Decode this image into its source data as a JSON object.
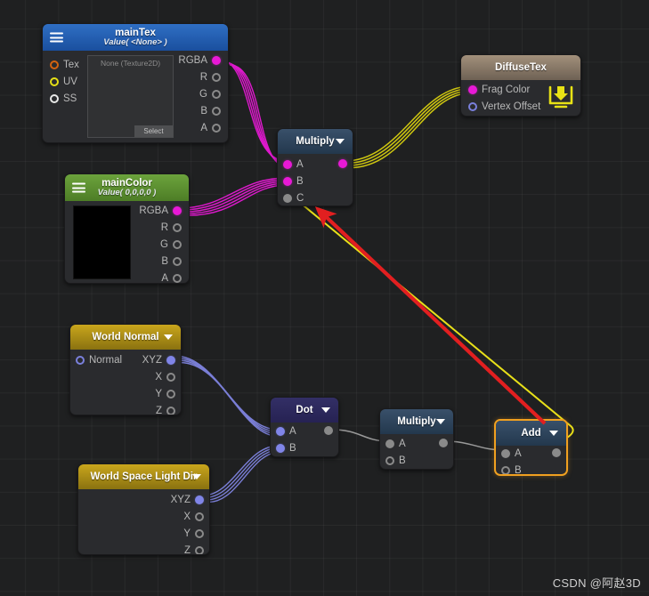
{
  "app": {
    "watermark": "CSDN @阿赵3D"
  },
  "nodes": {
    "main_tex": {
      "title": "mainTex",
      "subtitle": "Value( <None> )",
      "menu_icon": "hamburger-icon",
      "inputs": [
        {
          "label": "Tex",
          "port": "ring-orange"
        },
        {
          "label": "UV",
          "port": "ring-yellow"
        },
        {
          "label": "SS",
          "port": "ring-white"
        }
      ],
      "outputs": [
        {
          "label": "RGBA",
          "port": "filled-mag"
        },
        {
          "label": "R",
          "port": "ring-gray"
        },
        {
          "label": "G",
          "port": "ring-gray"
        },
        {
          "label": "B",
          "port": "ring-gray"
        },
        {
          "label": "A",
          "port": "ring-gray"
        }
      ],
      "texture_preview_label": "None (Texture2D)",
      "select_button": "Select"
    },
    "main_color": {
      "title": "mainColor",
      "subtitle": "Value( 0,0,0,0 )",
      "menu_icon": "hamburger-icon",
      "color_value": "#000000",
      "outputs": [
        {
          "label": "RGBA",
          "port": "filled-mag"
        },
        {
          "label": "R",
          "port": "ring-gray"
        },
        {
          "label": "G",
          "port": "ring-gray"
        },
        {
          "label": "B",
          "port": "ring-gray"
        },
        {
          "label": "A",
          "port": "ring-gray"
        }
      ]
    },
    "diffuse_tex": {
      "title": "DiffuseTex",
      "inputs": [
        {
          "label": "Frag Color",
          "port": "filled-mag"
        },
        {
          "label": "Vertex Offset",
          "port": "ring-blue"
        }
      ],
      "badge_icon": "save-download-icon"
    },
    "multiply_top": {
      "title": "Multiply",
      "dropdown_icon": "chevron-down-icon",
      "inputs": [
        {
          "label": "A",
          "port": "filled-mag"
        },
        {
          "label": "B",
          "port": "filled-mag"
        },
        {
          "label": "C",
          "port": "filled-gray"
        }
      ],
      "outputs": [
        {
          "label": "",
          "port": "filled-mag"
        }
      ]
    },
    "world_normal": {
      "title": "World Normal",
      "dropdown_icon": "chevron-down-icon",
      "inputs": [
        {
          "label": "Normal",
          "port": "ring-blue"
        }
      ],
      "outputs": [
        {
          "label": "XYZ",
          "port": "filled-blue"
        },
        {
          "label": "X",
          "port": "ring-gray"
        },
        {
          "label": "Y",
          "port": "ring-gray"
        },
        {
          "label": "Z",
          "port": "ring-gray"
        }
      ]
    },
    "world_light_dir": {
      "title": "World Space Light Dir",
      "dropdown_icon": "chevron-down-icon",
      "outputs": [
        {
          "label": "XYZ",
          "port": "filled-blue"
        },
        {
          "label": "X",
          "port": "ring-gray"
        },
        {
          "label": "Y",
          "port": "ring-gray"
        },
        {
          "label": "Z",
          "port": "ring-gray"
        }
      ]
    },
    "dot": {
      "title": "Dot",
      "dropdown_icon": "chevron-down-icon",
      "inputs": [
        {
          "label": "A",
          "port": "filled-blue"
        },
        {
          "label": "B",
          "port": "filled-blue"
        }
      ],
      "outputs": [
        {
          "label": "",
          "port": "filled-gray"
        }
      ]
    },
    "multiply_bottom": {
      "title": "Multiply",
      "dropdown_icon": "chevron-down-icon",
      "inputs": [
        {
          "label": "A",
          "port": "filled-gray"
        },
        {
          "label": "B",
          "port": "ring-gray"
        }
      ],
      "outputs": [
        {
          "label": "",
          "port": "filled-gray"
        }
      ]
    },
    "add": {
      "title": "Add",
      "dropdown_icon": "chevron-down-icon",
      "selected": true,
      "inputs": [
        {
          "label": "A",
          "port": "filled-gray"
        },
        {
          "label": "B",
          "port": "ring-gray"
        }
      ],
      "outputs": [
        {
          "label": "",
          "port": "filled-gray"
        }
      ]
    }
  },
  "colors": {
    "wire_magenta": "#e819d6",
    "wire_yellow": "#e8e019",
    "wire_blue": "#7f84e0",
    "wire_gray": "#9a9a9a",
    "annotation_red": "#e21f20",
    "selection_orange": "#f0a020",
    "canvas_bg": "#1f2021",
    "node_bg": "#2a2b2e"
  }
}
